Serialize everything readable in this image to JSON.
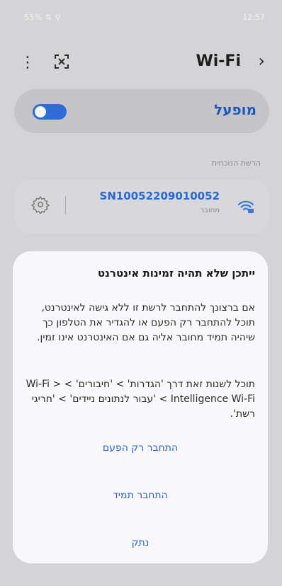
{
  "status": {
    "left": "55% ⇅ ⚲",
    "time": "12:57"
  },
  "appbar": {
    "title": "Wi-Fi",
    "kebab": "⋮"
  },
  "master": {
    "label": "מופעל",
    "on": true
  },
  "current_network": {
    "section_label": "הרשת הנוכחית",
    "ssid": "SN10052209010052",
    "status": "מחובר"
  },
  "dialog": {
    "title": "ייתכן שלא תהיה זמינות אינטרנט",
    "body1": "אם ברצונך להתחבר לרשת זו ללא גישה לאינטרנט, תוכל להתחבר רק הפעם או להגדיר את הטלפון כך שיהיה תמיד מחובר אליה גם אם האינטרנט אינו זמין.",
    "body2": "תוכל לשנות זאת דרך 'הגדרות' > 'חיבורים' > Wi-Fi > Intelligence Wi-Fi > 'עבור לנתונים ניידים' > 'חריגי רשת'.",
    "buttons": {
      "connect_once": "התחבר רק הפעם",
      "always_connect": "התחבר תמיד",
      "disconnect": "נתק"
    }
  }
}
